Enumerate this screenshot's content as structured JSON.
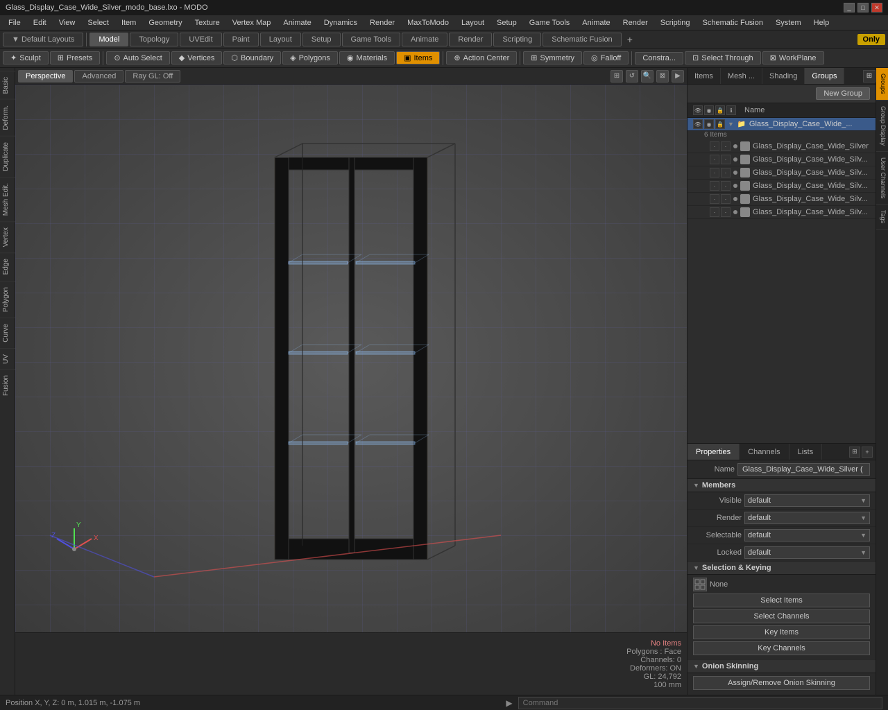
{
  "titlebar": {
    "title": "Glass_Display_Case_Wide_Silver_modo_base.lxo - MODO",
    "controls": [
      "_",
      "□",
      "✕"
    ]
  },
  "menubar": {
    "items": [
      "File",
      "Edit",
      "View",
      "Select",
      "Item",
      "Geometry",
      "Texture",
      "Vertex Map",
      "Animate",
      "Dynamics",
      "Render",
      "MaxToModo",
      "Layout",
      "Setup",
      "Game Tools",
      "Animate",
      "Render",
      "Scripting",
      "Schematic Fusion"
    ]
  },
  "layout_tabs": {
    "tabs": [
      "Model",
      "Topology",
      "UVEdit",
      "Paint",
      "Layout",
      "Setup",
      "Game Tools",
      "Animate",
      "Render",
      "Scripting",
      "Schematic Fusion"
    ],
    "active": "Model",
    "plus_label": "+",
    "right": {
      "only_label": "Only"
    }
  },
  "toolbar": {
    "left_tools": [
      "Sculpt",
      "Presets"
    ],
    "selection_tools": [
      "Auto Select",
      "Vertices",
      "Boundary",
      "Polygons",
      "Materials",
      "Items"
    ],
    "right_tools": [
      "Action Center",
      "Symmetry",
      "Falloff",
      "Constra...",
      "Select Through",
      "WorkPlane"
    ],
    "items_active": true
  },
  "viewport": {
    "tabs": [
      "Perspective",
      "Advanced",
      "Ray GL: Off"
    ],
    "active_tab": "Perspective",
    "icons": [
      "⊞",
      "↺",
      "🔍",
      "⊠",
      "▶"
    ]
  },
  "model_3d": {
    "description": "Glass Display Case Wide Silver"
  },
  "status": {
    "no_items": "No Items",
    "polygons": "Polygons : Face",
    "channels": "Channels: 0",
    "deformers": "Deformers: ON",
    "gl": "GL: 24,792",
    "size": "100 mm",
    "position": "Position X, Y, Z:  0 m, 1.015 m, -1.075 m"
  },
  "right_panel": {
    "tabs": [
      "Items",
      "Mesh ...",
      "Shading",
      "Groups"
    ],
    "active_tab": "Groups",
    "new_group_btn": "New Group",
    "column_header": {
      "name_label": "Name"
    },
    "groups": [
      {
        "id": "group1",
        "label": "Glass_Display_Case_Wide_...",
        "count": "6 Items",
        "expanded": true,
        "selected": true,
        "icon": "📁"
      }
    ],
    "sub_items": [
      {
        "id": "sub1",
        "label": "Glass_Display_Case_Wide_Silver"
      },
      {
        "id": "sub2",
        "label": "Glass_Display_Case_Wide_Silv..."
      },
      {
        "id": "sub3",
        "label": "Glass_Display_Case_Wide_Silv..."
      },
      {
        "id": "sub4",
        "label": "Glass_Display_Case_Wide_Silv..."
      },
      {
        "id": "sub5",
        "label": "Glass_Display_Case_Wide_Silv..."
      },
      {
        "id": "sub6",
        "label": "Glass_Display_Case_Wide_Silv..."
      }
    ]
  },
  "properties": {
    "tabs": [
      "Properties",
      "Channels",
      "Lists"
    ],
    "active_tab": "Properties",
    "name_label": "Name",
    "name_value": "Glass_Display_Case_Wide_Silver (",
    "members_section": {
      "title": "Members",
      "visible_label": "Visible",
      "visible_value": "default",
      "render_label": "Render",
      "render_value": "default",
      "selectable_label": "Selectable",
      "selectable_value": "default",
      "locked_label": "Locked",
      "locked_value": "default"
    },
    "keying_section": {
      "title": "Selection & Keying",
      "none_label": "None",
      "select_items_btn": "Select Items",
      "select_channels_btn": "Select Channels",
      "key_items_btn": "Key Items",
      "key_channels_btn": "Key Channels"
    },
    "onion_section": {
      "title": "Onion Skinning",
      "assign_btn": "Assign/Remove Onion Skinning"
    }
  },
  "right_vtabs": [
    "Groups",
    "Group Display",
    "User Channels",
    "Tags"
  ],
  "command_bar": {
    "prompt_label": "Command",
    "placeholder": "Command"
  }
}
